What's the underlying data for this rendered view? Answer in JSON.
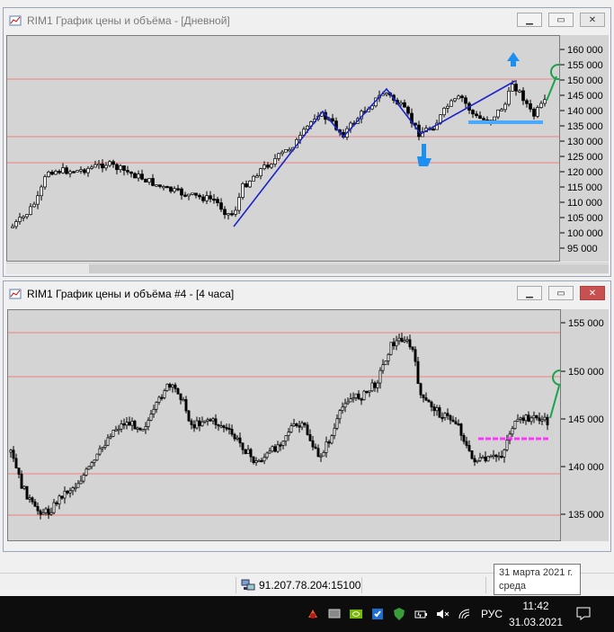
{
  "window1": {
    "title": "RIM1 График цены и объёма - [Дневной]",
    "price_ticks": [
      "160 000",
      "155 000",
      "150 000",
      "145 000",
      "140 000",
      "135 000",
      "130 000",
      "125 000",
      "120 000",
      "115 000",
      "110 000",
      "105 000",
      "100 000",
      "95 000"
    ]
  },
  "window2": {
    "title": "RIM1 График цены и объёма #4 - [4 часа]",
    "price_ticks": [
      "155 000",
      "150 000",
      "145 000",
      "140 000",
      "135 000"
    ]
  },
  "status": {
    "connection": "91.207.78.204:15100"
  },
  "tooltip": {
    "date": "31 марта 2021 г.",
    "weekday": "среда"
  },
  "taskbar": {
    "language": "РУС",
    "time": "11:42",
    "date": "31.03.2021"
  },
  "colors": {
    "line": "#1c24c8",
    "level_line": "#f08080",
    "support_blue": "#4aa8ff",
    "support_magenta": "#ff33ff",
    "target_green": "#19a34a",
    "arrow_blue": "#1c8ff0"
  }
}
